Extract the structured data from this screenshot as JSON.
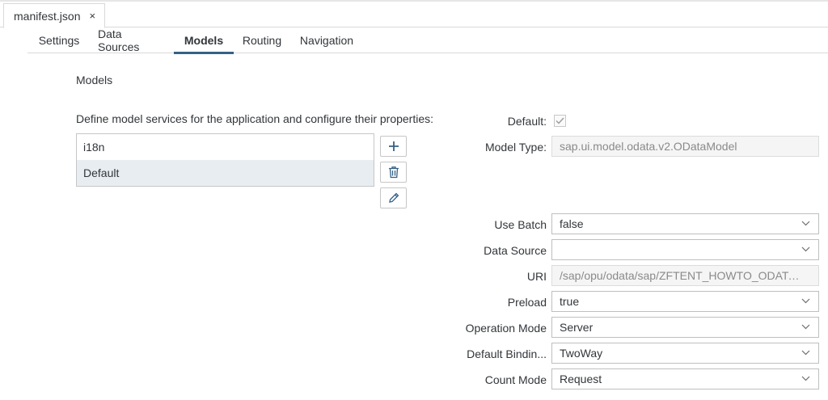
{
  "file_tab": {
    "title": "manifest.json",
    "close": "×"
  },
  "nav": {
    "tabs": [
      {
        "label": "Settings"
      },
      {
        "label": "Data Sources"
      },
      {
        "label": "Models"
      },
      {
        "label": "Routing"
      },
      {
        "label": "Navigation"
      }
    ],
    "active": "Models"
  },
  "section": {
    "title": "Models",
    "intro": "Define model services for the application and configure their properties:"
  },
  "models_list": [
    {
      "label": "i18n"
    },
    {
      "label": "Default"
    }
  ],
  "list_buttons": {
    "add": "plus-icon",
    "delete": "trash-icon",
    "edit": "pencil-icon"
  },
  "props": {
    "default": {
      "label": "Default:",
      "checked": true
    },
    "model_type": {
      "label": "Model Type:",
      "value": "sap.ui.model.odata.v2.ODataModel"
    },
    "use_batch": {
      "label": "Use Batch",
      "value": "false"
    },
    "data_source": {
      "label": "Data Source",
      "value": ""
    },
    "uri": {
      "label": "URI",
      "value": "/sap/opu/odata/sap/ZFTENT_HOWTO_ODATA_S..."
    },
    "preload": {
      "label": "Preload",
      "value": "true"
    },
    "operation_mode": {
      "label": "Operation Mode",
      "value": "Server"
    },
    "default_binding": {
      "label": "Default Bindin...",
      "value": "TwoWay"
    },
    "count_mode": {
      "label": "Count Mode",
      "value": "Request"
    }
  },
  "colors": {
    "accent": "#346187",
    "selected_row": "#e8edf2",
    "text": "#32363a"
  }
}
